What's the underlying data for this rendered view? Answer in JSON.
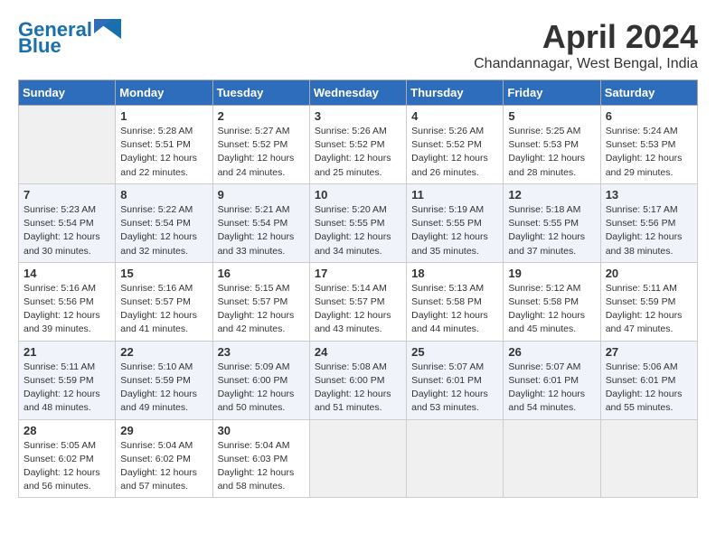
{
  "header": {
    "logo_general": "General",
    "logo_blue": "Blue",
    "month": "April 2024",
    "location": "Chandannagar, West Bengal, India"
  },
  "weekdays": [
    "Sunday",
    "Monday",
    "Tuesday",
    "Wednesday",
    "Thursday",
    "Friday",
    "Saturday"
  ],
  "weeks": [
    [
      {
        "day": "",
        "empty": true
      },
      {
        "day": "1",
        "sunrise": "5:28 AM",
        "sunset": "5:51 PM",
        "daylight": "12 hours and 22 minutes."
      },
      {
        "day": "2",
        "sunrise": "5:27 AM",
        "sunset": "5:52 PM",
        "daylight": "12 hours and 24 minutes."
      },
      {
        "day": "3",
        "sunrise": "5:26 AM",
        "sunset": "5:52 PM",
        "daylight": "12 hours and 25 minutes."
      },
      {
        "day": "4",
        "sunrise": "5:26 AM",
        "sunset": "5:52 PM",
        "daylight": "12 hours and 26 minutes."
      },
      {
        "day": "5",
        "sunrise": "5:25 AM",
        "sunset": "5:53 PM",
        "daylight": "12 hours and 28 minutes."
      },
      {
        "day": "6",
        "sunrise": "5:24 AM",
        "sunset": "5:53 PM",
        "daylight": "12 hours and 29 minutes."
      }
    ],
    [
      {
        "day": "7",
        "sunrise": "5:23 AM",
        "sunset": "5:54 PM",
        "daylight": "12 hours and 30 minutes."
      },
      {
        "day": "8",
        "sunrise": "5:22 AM",
        "sunset": "5:54 PM",
        "daylight": "12 hours and 32 minutes."
      },
      {
        "day": "9",
        "sunrise": "5:21 AM",
        "sunset": "5:54 PM",
        "daylight": "12 hours and 33 minutes."
      },
      {
        "day": "10",
        "sunrise": "5:20 AM",
        "sunset": "5:55 PM",
        "daylight": "12 hours and 34 minutes."
      },
      {
        "day": "11",
        "sunrise": "5:19 AM",
        "sunset": "5:55 PM",
        "daylight": "12 hours and 35 minutes."
      },
      {
        "day": "12",
        "sunrise": "5:18 AM",
        "sunset": "5:55 PM",
        "daylight": "12 hours and 37 minutes."
      },
      {
        "day": "13",
        "sunrise": "5:17 AM",
        "sunset": "5:56 PM",
        "daylight": "12 hours and 38 minutes."
      }
    ],
    [
      {
        "day": "14",
        "sunrise": "5:16 AM",
        "sunset": "5:56 PM",
        "daylight": "12 hours and 39 minutes."
      },
      {
        "day": "15",
        "sunrise": "5:16 AM",
        "sunset": "5:57 PM",
        "daylight": "12 hours and 41 minutes."
      },
      {
        "day": "16",
        "sunrise": "5:15 AM",
        "sunset": "5:57 PM",
        "daylight": "12 hours and 42 minutes."
      },
      {
        "day": "17",
        "sunrise": "5:14 AM",
        "sunset": "5:57 PM",
        "daylight": "12 hours and 43 minutes."
      },
      {
        "day": "18",
        "sunrise": "5:13 AM",
        "sunset": "5:58 PM",
        "daylight": "12 hours and 44 minutes."
      },
      {
        "day": "19",
        "sunrise": "5:12 AM",
        "sunset": "5:58 PM",
        "daylight": "12 hours and 45 minutes."
      },
      {
        "day": "20",
        "sunrise": "5:11 AM",
        "sunset": "5:59 PM",
        "daylight": "12 hours and 47 minutes."
      }
    ],
    [
      {
        "day": "21",
        "sunrise": "5:11 AM",
        "sunset": "5:59 PM",
        "daylight": "12 hours and 48 minutes."
      },
      {
        "day": "22",
        "sunrise": "5:10 AM",
        "sunset": "5:59 PM",
        "daylight": "12 hours and 49 minutes."
      },
      {
        "day": "23",
        "sunrise": "5:09 AM",
        "sunset": "6:00 PM",
        "daylight": "12 hours and 50 minutes."
      },
      {
        "day": "24",
        "sunrise": "5:08 AM",
        "sunset": "6:00 PM",
        "daylight": "12 hours and 51 minutes."
      },
      {
        "day": "25",
        "sunrise": "5:07 AM",
        "sunset": "6:01 PM",
        "daylight": "12 hours and 53 minutes."
      },
      {
        "day": "26",
        "sunrise": "5:07 AM",
        "sunset": "6:01 PM",
        "daylight": "12 hours and 54 minutes."
      },
      {
        "day": "27",
        "sunrise": "5:06 AM",
        "sunset": "6:01 PM",
        "daylight": "12 hours and 55 minutes."
      }
    ],
    [
      {
        "day": "28",
        "sunrise": "5:05 AM",
        "sunset": "6:02 PM",
        "daylight": "12 hours and 56 minutes."
      },
      {
        "day": "29",
        "sunrise": "5:04 AM",
        "sunset": "6:02 PM",
        "daylight": "12 hours and 57 minutes."
      },
      {
        "day": "30",
        "sunrise": "5:04 AM",
        "sunset": "6:03 PM",
        "daylight": "12 hours and 58 minutes."
      },
      {
        "day": "",
        "empty": true
      },
      {
        "day": "",
        "empty": true
      },
      {
        "day": "",
        "empty": true
      },
      {
        "day": "",
        "empty": true
      }
    ]
  ],
  "labels": {
    "sunrise": "Sunrise:",
    "sunset": "Sunset:",
    "daylight": "Daylight:"
  }
}
